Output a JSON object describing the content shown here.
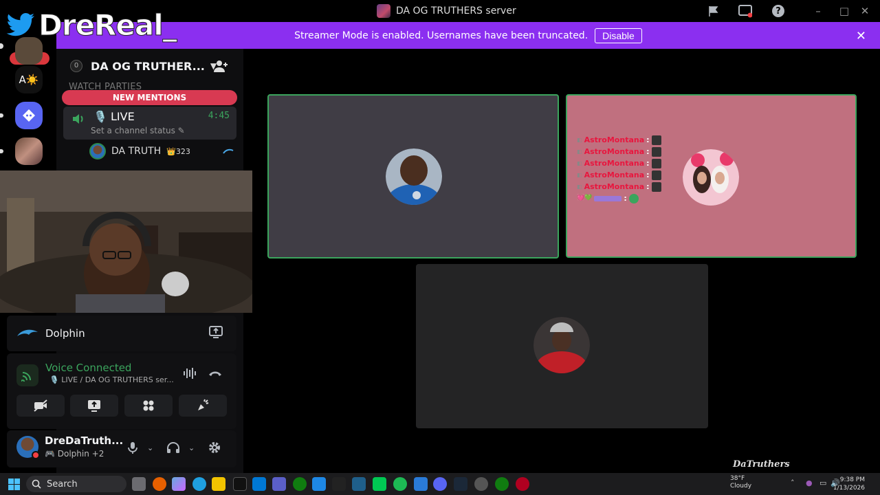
{
  "titlebar": {
    "title": "DA OG TRUTHERS server"
  },
  "banner": {
    "message": "Streamer Mode is enabled. Usernames have been truncated.",
    "button": "Disable"
  },
  "overlay": {
    "brand": "DreReal_"
  },
  "rail": {
    "new_badge": "NEW",
    "items": [
      "A☀️"
    ]
  },
  "server": {
    "boost_count": "0",
    "name": "DA OG TRUTHER...",
    "category": "WATCH PARTIES"
  },
  "mentions": {
    "label": "NEW MENTIONS"
  },
  "live_channel": {
    "name": "LIVE",
    "timer": "4:45",
    "status": "Set a channel status"
  },
  "members": [
    {
      "name": "DA TRUTH",
      "badge": "323"
    }
  ],
  "activity": {
    "name": "Dolphin"
  },
  "voice": {
    "title": "Voice Connected",
    "channel": "LIVE / DA OG TRUTHERS ser..."
  },
  "user": {
    "name": "DreDaTruth...",
    "activity": "Dolphin",
    "extra": "+2"
  },
  "stage": {
    "chat": [
      {
        "name": "AstroMontana",
        "sep": ":"
      },
      {
        "name": "AstroMontana",
        "sep": ":"
      },
      {
        "name": "AstroMontana",
        "sep": ":"
      },
      {
        "name": "AstroMontana",
        "sep": ":"
      },
      {
        "name": "AstroMontana",
        "sep": ":"
      }
    ]
  },
  "watermark": "DaTruthers",
  "taskbar": {
    "search": "Search",
    "weather_temp": "38°F",
    "weather_desc": "Cloudy",
    "time": "9:38 PM",
    "date": "1/13/2026"
  },
  "colors": {
    "banner": "#8b2ff0",
    "mentions": "#d83a52",
    "voice_green": "#3ba55d",
    "tile_pink": "#c0707f"
  }
}
